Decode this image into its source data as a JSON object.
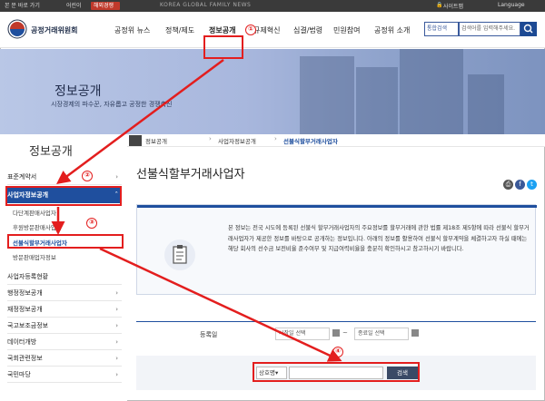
{
  "topbar": {
    "tabs": [
      "본 문 바로 가기",
      "어린이",
      "해외경쟁"
    ],
    "news": "KOREA GLOBAL FAMILY NEWS",
    "sitemap": "사이트맵",
    "language": "Language"
  },
  "header": {
    "brand": "공정거래위원회",
    "gnb": [
      "공정위 뉴스",
      "정책/제도",
      "정보공개",
      "규제혁신",
      "심결/법령",
      "민원참여",
      "공정위 소개"
    ],
    "search_scope": "통합검색",
    "search_placeholder": "검색어를 입력해주세요."
  },
  "hero": {
    "title": "정보공개",
    "subtitle": "시장경제의 파수꾼, 자유롭고 공정한 경쟁촉진"
  },
  "sidebar": {
    "title": "정보공개",
    "items": [
      "표준계약서",
      "사업자정보공개",
      "사업자등록현황",
      "행정정보공개",
      "재정정보공개",
      "국고보조금정보",
      "데이터개방",
      "국회관련정보",
      "국민마당"
    ],
    "subitems": [
      "다단계판매사업자",
      "후원방문판매사업자",
      "선불식할부거래사업자",
      "방문판매업자정보"
    ]
  },
  "breadcrumb": [
    "정보공개",
    "사업자정보공개",
    "선불식할부거래사업자"
  ],
  "page": {
    "title": "선불식할부거래사업자",
    "info_text": "본 정보는 전국 시도에 등록된 선불식 할부거래사업자의 주요정보를 할부거래에 관한 법률 제18조 제5항에 따라 선불식 할부거래사업자가 제공한 정보를 바탕으로 공개하는 정보입니다. 아래의 정보를 활용하여 선불식 할부계약을 체결하고자 하실 때에는 해당 회사의 선수금 보전비율 준수여부 및 지급여력비율을 충분히 확인하시고 참고하시기 바랍니다."
  },
  "filter": {
    "label": "등록일",
    "start": "시작일 선택",
    "tilde": "~",
    "end": "종료일 선택"
  },
  "search": {
    "select": "상호명",
    "button": "검색"
  },
  "annotations": [
    "①",
    "②",
    "③",
    "④"
  ],
  "colors": {
    "accent": "#1f4f9e",
    "annotation": "#e31e1e",
    "topbar": "#3a3a3a"
  }
}
